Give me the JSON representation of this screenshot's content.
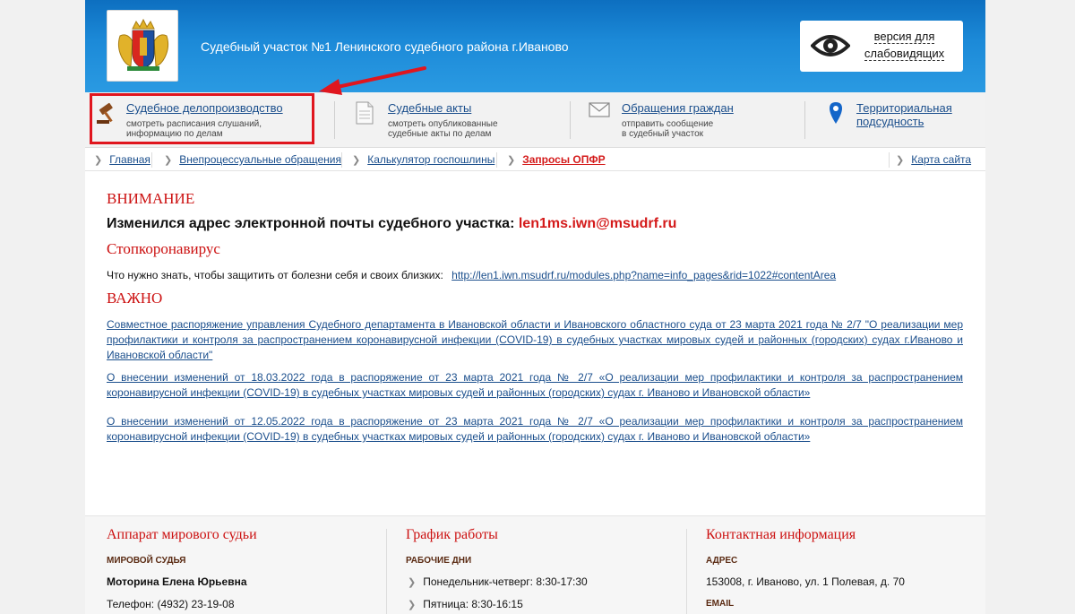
{
  "header": {
    "title": "Судебный участок №1 Ленинского судебного района г.Иваново",
    "vi_button": {
      "line1": "версия для",
      "line2": "слабовидящих",
      "icon": "eye-icon"
    },
    "colors": {
      "header_blue": "#1c8ad8",
      "accent_red": "#cc1111",
      "link_blue": "#1a4e8c"
    }
  },
  "services": [
    {
      "title": "Судебное делопроизводство",
      "desc1": "смотреть расписания слушаний,",
      "desc2": "информацию по делам",
      "icon": "gavel-icon"
    },
    {
      "title": "Судебные акты",
      "desc1": "смотреть опубликованные",
      "desc2": "судебные акты по делам",
      "icon": "document-icon"
    },
    {
      "title": "Обращения граждан",
      "desc1": "отправить сообщение",
      "desc2": "в судебный участок",
      "icon": "envelope-icon"
    },
    {
      "title1": "Территориальная",
      "title2": "подсудность",
      "icon": "map-pin-icon"
    }
  ],
  "nav": {
    "items": [
      "Главная",
      "Внепроцессуальные обращения",
      "Калькулятор госпошлины",
      "Запросы ОПФР"
    ],
    "sitemap": "Карта сайта"
  },
  "content": {
    "attention": "ВНИМАНИЕ",
    "email_text": "Изменился адрес электронной почты судебного участка:",
    "email_addr": "len1ms.iwn@msudrf.ru",
    "stopcovid": "Стопкоронавирус",
    "covid_text": "Что нужно знать, чтобы защитить от болезни себя и своих близких:",
    "covid_link": "http://len1.iwn.msudrf.ru/modules.php?name=info_pages&rid=1022#contentArea",
    "important": "ВАЖНО",
    "doc1": "Совместное распоряжение управления Судебного департамента в Ивановской области и Ивановского областного суда от 23 марта 2021 года № 2/7 \"О реализации мер профилактики и контроля за распространением коронавирусной инфекции (COVID-19) в судебных участках мировых судей и районных (городских) судах г.Иваново и Ивановской области\"",
    "doc2": "О внесении изменений от 18.03.2022 года в распоряжение от 23 марта 2021 года № 2/7 «О реализации мер профилактики и контроля за распространением коронавирусной инфекции (COVID-19) в судебных участках мировых судей и районных (городских) судах г. Иваново и Ивановской области»",
    "doc3": "О внесении изменений от 12.05.2022 года в распоряжение от 23 марта 2021 года № 2/7 «О реализации мер профилактики и контроля за распространением коронавирусной инфекции (COVID-19) в судебных участках мировых судей и районных (городских) судах г. Иваново и Ивановской области»"
  },
  "footer": {
    "col1": {
      "title": "Аппарат мирового судьи",
      "label": "МИРОВОЙ СУДЬЯ",
      "name": "Моторина Елена Юрьевна",
      "phone": "Телефон:  (4932) 23-19-08"
    },
    "col2": {
      "title": "График работы",
      "label": "РАБОЧИЕ ДНИ",
      "line1": "Понедельник-четверг: 8:30-17:30",
      "line2": "Пятница: 8:30-16:15"
    },
    "col3": {
      "title": "Контактная информация",
      "label1": "АДРЕС",
      "address": "153008, г. Иваново, ул. 1 Полевая, д. 70",
      "label2": "EMAIL"
    }
  }
}
